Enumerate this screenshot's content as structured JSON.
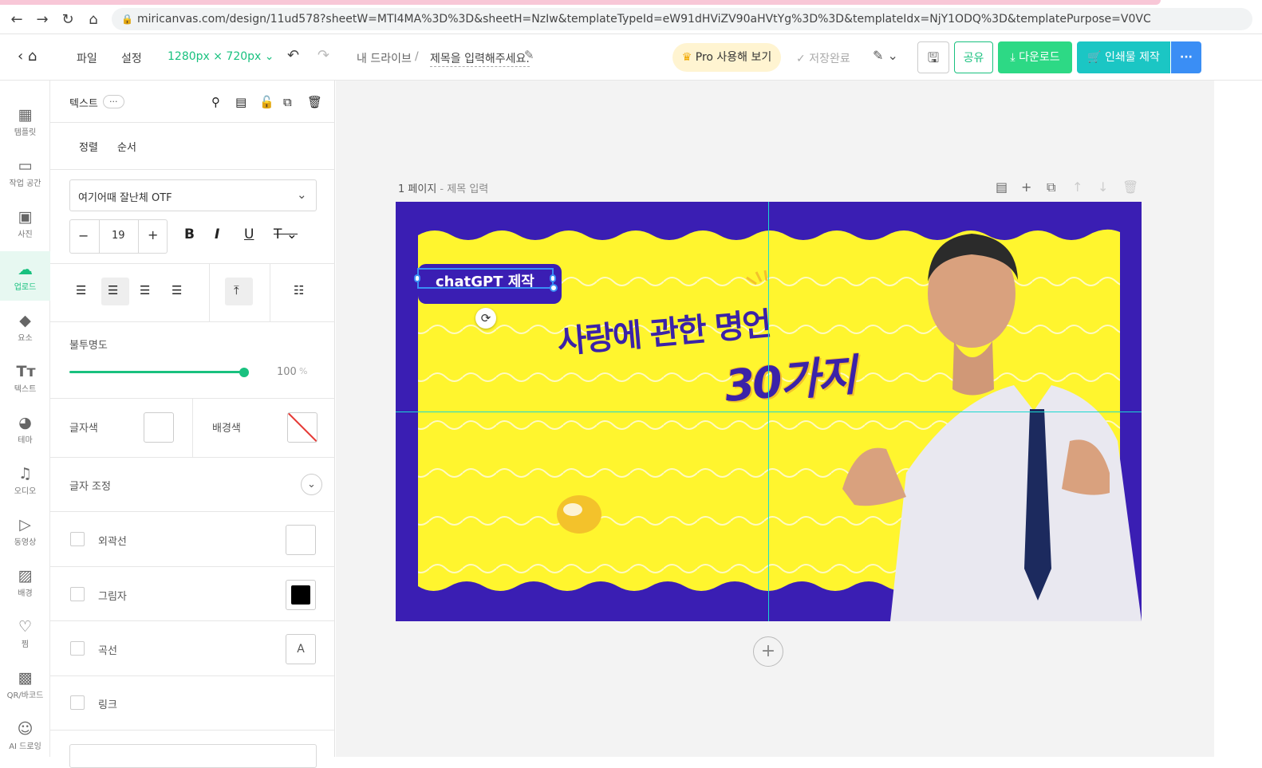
{
  "browser": {
    "url": "miricanvas.com/design/11ud578?sheetW=MTI4MA%3D%3D&sheetH=NzIw&templateTypeId=eW91dHViZV90aHVtYg%3D%3D&templateIdx=NjY1ODQ%3D&templatePurpose=V0VC"
  },
  "header": {
    "file": "파일",
    "settings": "설정",
    "size": "1280px × 720px",
    "breadcrumb_drive": "내 드라이브",
    "breadcrumb_sep": "/",
    "title": "제목을 입력해주세요.",
    "pro": "Pro 사용해 보기",
    "save_status": "저장완료",
    "share": "공유",
    "download": "다운로드",
    "print": "인쇄물 제작",
    "more": "···"
  },
  "rail": [
    {
      "label": "템플릿",
      "icon": "template-icon"
    },
    {
      "label": "작업 공간",
      "icon": "workspace-icon"
    },
    {
      "label": "사진",
      "icon": "photo-icon"
    },
    {
      "label": "업로드",
      "icon": "upload-icon"
    },
    {
      "label": "요소",
      "icon": "elements-icon"
    },
    {
      "label": "텍스트",
      "icon": "text-icon"
    },
    {
      "label": "테마",
      "icon": "palette-icon"
    },
    {
      "label": "오디오",
      "icon": "music-icon"
    },
    {
      "label": "동영상",
      "icon": "video-icon"
    },
    {
      "label": "배경",
      "icon": "background-icon"
    },
    {
      "label": "찜",
      "icon": "heart-icon"
    },
    {
      "label": "QR/바코드",
      "icon": "qr-icon"
    },
    {
      "label": "AI 드로잉",
      "icon": "ai-icon"
    }
  ],
  "panel": {
    "header_label": "텍스트",
    "header_more": "···",
    "tab_align": "정렬",
    "tab_order": "순서",
    "font_name": "여기어때 잘난체 OTF",
    "font_size": "19",
    "opacity_label": "불투명도",
    "opacity_value": "100",
    "opacity_unit": "%",
    "opacity_level": 1.0,
    "text_color_label": "글자색",
    "bg_color_label": "배경색",
    "letter_adjust": "글자 조정",
    "outline_label": "외곽선",
    "shadow_label": "그림자",
    "curve_label": "곡선",
    "link_label": "링크"
  },
  "workspace": {
    "page_number": "1 페이지",
    "page_title_sep": " - ",
    "page_title": "제목 입력"
  },
  "canvas": {
    "tag_text": "chatGPT 제작",
    "headline1": "사랑에 관한 명언",
    "headline2": "30가지",
    "colors": {
      "background": "#3a1eb3",
      "yellow": "#fff52e",
      "accent": "#3b22a8"
    }
  },
  "colors": {
    "green": "#19c17f",
    "green_btn": "#2dd985",
    "teal_btn": "#1bc6c4",
    "blue_btn": "#3a8ef5"
  }
}
